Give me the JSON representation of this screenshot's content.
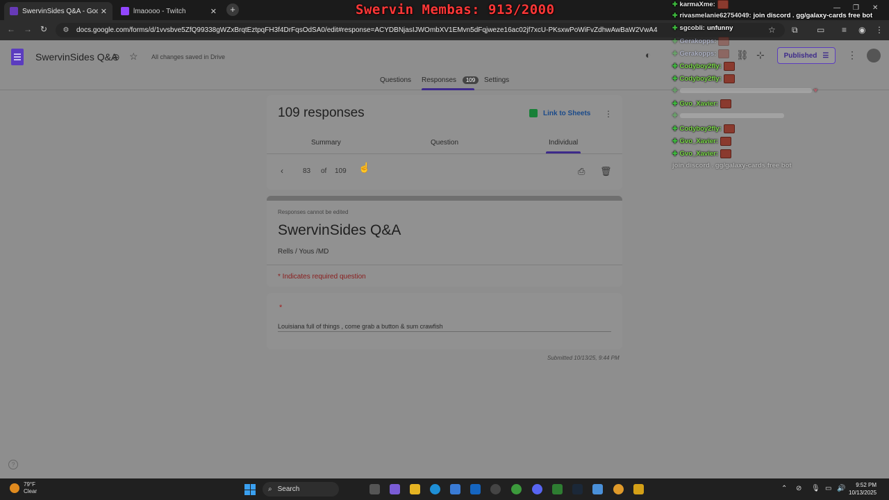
{
  "browser": {
    "tabs": [
      {
        "title": "SwervinSides Q&A - Google Fo",
        "active": true,
        "favicon_color": "#673ab7"
      },
      {
        "title": "lmaoooo - Twitch",
        "active": false,
        "favicon_color": "#9146ff"
      }
    ],
    "overlay_title": "Swervin Membas: 913/2000",
    "url": "docs.google.com/forms/d/1vvsbve5ZfQ99338gWZxBrqtEztpqFH3f4DrFqsOdSA0/edit#response=ACYDBNjasIJWOmbXV1EMvn5dFqjweze16ac02jf7xcU-PKsxwPoWiFvZdhwAwBaW2VwA4"
  },
  "form_header": {
    "title": "SwervinSides Q&A",
    "saved_status": "All changes saved in Drive",
    "publish_label": "Published",
    "tabs": {
      "questions": "Questions",
      "responses": "Responses",
      "responses_count": "109",
      "settings": "Settings"
    }
  },
  "responses_card": {
    "title": "109 responses",
    "link_sheets_label": "Link to Sheets",
    "subtabs": {
      "summary": "Summary",
      "question": "Question",
      "individual": "Individual"
    },
    "pager": {
      "current": "83",
      "of_label": "of",
      "total": "109"
    }
  },
  "form_card": {
    "note": "Responses cannot be edited",
    "title": "SwervinSides Q&A",
    "description": "Rells / Yous /MD",
    "required_note": "* Indicates required question"
  },
  "question_card": {
    "asterisk": "*",
    "answer": "Louisiana full of things , come grab a button & sum crawfish"
  },
  "submitted": "Submitted 10/13/25, 9:44 PM",
  "chat": [
    {
      "user": "karmaXme:",
      "user_color": "#e8e8e8",
      "message": "",
      "emote": true,
      "faded": false
    },
    {
      "user": "rivasmelanie62754049:",
      "user_color": "#e8e8e8",
      "message": "join discord . gg/galaxy-cards free bot",
      "emote": false,
      "faded": false
    },
    {
      "user": "sgcobli:",
      "user_color": "#e8e8e8",
      "message": "unfunny",
      "emote": false,
      "faded": false
    },
    {
      "user": "Gerakopps:",
      "user_color": "#cfd8ff",
      "message": "",
      "emote": true,
      "faded": true
    },
    {
      "user": "Gerakopps:",
      "user_color": "#cfd8ff",
      "message": "",
      "emote": true,
      "faded": true
    },
    {
      "user": "Codyboy2fly:",
      "user_color": "#7ddc4a",
      "message": "",
      "emote": true,
      "faded": false
    },
    {
      "user": "Codyboy2fly:",
      "user_color": "#7ddc4a",
      "message": "",
      "emote": true,
      "faded": false
    },
    {
      "user": "",
      "user_color": "#7ddc4a",
      "message": "",
      "emote": false,
      "faded": true
    },
    {
      "user": "Gvo_Xavier:",
      "user_color": "#7ddc4a",
      "message": "",
      "emote": true,
      "faded": false
    },
    {
      "user": "",
      "user_color": "#cfd8ff",
      "message": "",
      "emote": false,
      "faded": true
    },
    {
      "user": "Codyboy2fly:",
      "user_color": "#7ddc4a",
      "message": "",
      "emote": true,
      "faded": false
    },
    {
      "user": "Gvo_Xavier:",
      "user_color": "#7ddc4a",
      "message": "",
      "emote": true,
      "faded": false
    },
    {
      "user": "Gvo_Xavier:",
      "user_color": "#7ddc4a",
      "message": "",
      "emote": true,
      "faded": false
    },
    {
      "user": "",
      "user_color": "#e8e8e8",
      "message": "join discord . gg/galaxy-cards free bot",
      "emote": false,
      "faded": true
    }
  ],
  "taskbar": {
    "weather_temp": "79°F",
    "weather_desc": "Clear",
    "search_label": "Search",
    "time": "9:52 PM",
    "date": "10/13/2025"
  },
  "colors": {
    "accent": "#673ab7",
    "overlay_red": "#ff3838",
    "required_red": "#8a1c1c",
    "link_blue": "#1a4a8a"
  }
}
